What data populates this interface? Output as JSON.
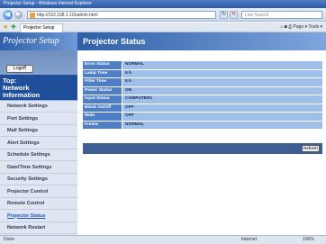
{
  "browser": {
    "window_title": "Projector Setup - Windows Internet Explorer",
    "address": "http://192.168.1.10/admin.html",
    "search_placeholder": "Live Search",
    "tab_title": "Projector Setup",
    "command_bar": "Page ▾  Tools ▾"
  },
  "sidebar": {
    "logo": "Projector Setup",
    "logoff_label": "Logoff",
    "top_title": "Top:\nNetwork\nInformation",
    "items": [
      {
        "label": "Network Settings"
      },
      {
        "label": "Port Settings"
      },
      {
        "label": "Mail Settings"
      },
      {
        "label": "Alert Settings"
      },
      {
        "label": "Schedule Settings"
      },
      {
        "label": "Date/Time Settings"
      },
      {
        "label": "Security Settings"
      },
      {
        "label": "Projector Control"
      },
      {
        "label": "Remote Control"
      },
      {
        "label": "Projector Status"
      },
      {
        "label": "Network Restart"
      }
    ],
    "active_index": 9
  },
  "main": {
    "title": "Projector Status",
    "rows": [
      {
        "label": "Error Status",
        "value": "NORMAL"
      },
      {
        "label": "Lamp Time",
        "value": "5 h"
      },
      {
        "label": "Filter Time",
        "value": "5 h"
      },
      {
        "label": "Power Status",
        "value": "ON"
      },
      {
        "label": "Input Status",
        "value": "COMPUTER1"
      },
      {
        "label": "Blank On/Off",
        "value": "OFF"
      },
      {
        "label": "Mute",
        "value": "OFF"
      },
      {
        "label": "Freeze",
        "value": "NORMAL"
      }
    ],
    "refresh_label": "Refresh"
  },
  "statusbar": {
    "left": "Done",
    "zone": "Internet",
    "zoom": "100%"
  },
  "colors": {
    "header_blue": "#2f5fa8",
    "label_blue": "#4e7ec6",
    "value_blue": "#9fbfe9",
    "sidebar_bg": "#dfe6f2"
  }
}
